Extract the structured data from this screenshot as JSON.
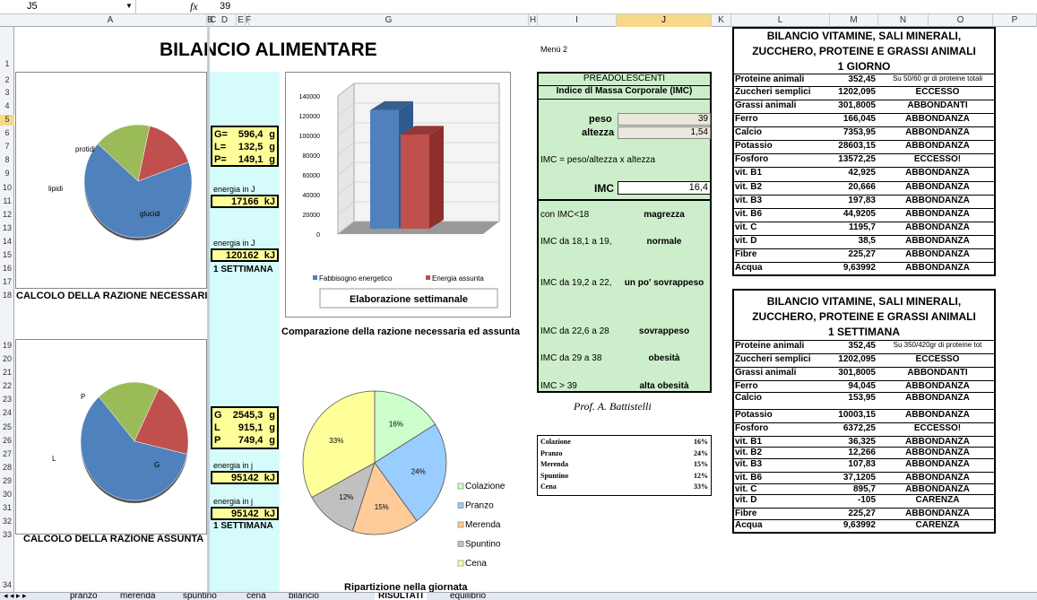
{
  "formula_bar": {
    "cell_ref": "J5",
    "fx": "fx",
    "value": "39"
  },
  "columns": [
    "A",
    "B",
    "C",
    "D",
    "E",
    "F",
    "G",
    "H",
    "I",
    "J",
    "K",
    "L",
    "M",
    "N",
    "O",
    "P"
  ],
  "rows": [
    "1",
    "2",
    "3",
    "4",
    "5",
    "6",
    "7",
    "8",
    "9",
    "10",
    "11",
    "12",
    "13",
    "14",
    "15",
    "16",
    "17",
    "18",
    "19",
    "20",
    "21",
    "22",
    "23",
    "24",
    "25",
    "26",
    "27",
    "28",
    "29",
    "30",
    "31",
    "32",
    "33",
    "34"
  ],
  "title": "BILANCIO ALIMENTARE",
  "menu_link": "Menù 2",
  "pie1": {
    "labels": [
      "protidi",
      "lipidi",
      "glucidi"
    ],
    "values": [
      17,
      16,
      67
    ],
    "colors": [
      "#9bbb59",
      "#c0504d",
      "#4f81bd"
    ]
  },
  "pie2": {
    "labels": [
      "P",
      "L",
      "G"
    ],
    "values": [
      19,
      21,
      60
    ],
    "colors": [
      "#9bbb59",
      "#c0504d",
      "#4f81bd"
    ]
  },
  "caption_necessaria": "CALCOLO DELLA RAZIONE NECESSARIA",
  "caption_assunta": "CALCOLO DELLA RAZIONE ASSUNTA",
  "box1": [
    {
      "k": "G=",
      "v": "596,4",
      "u": "g"
    },
    {
      "k": "L=",
      "v": "132,5",
      "u": "g"
    },
    {
      "k": "P=",
      "v": "149,1",
      "u": "g"
    }
  ],
  "energy1_label": "energia in J",
  "energy1": "17166",
  "energy_unit": "kJ",
  "energy2_label": "energia in J",
  "energy2": "120162",
  "settimana": "1 SETTIMANA",
  "box2": [
    {
      "k": "G",
      "v": "2545,3",
      "u": "g"
    },
    {
      "k": "L",
      "v": "915,1",
      "u": "g"
    },
    {
      "k": "P",
      "v": "749,4",
      "u": "g"
    }
  ],
  "energy3_label": "energia in j",
  "energy3": "95142",
  "energy4_label": "energia in j",
  "energy4": "95142",
  "bar_chart": {
    "yticks": [
      "140000",
      "120000",
      "100000",
      "80000",
      "60000",
      "40000",
      "20000",
      "0"
    ],
    "ylim": [
      0,
      140000
    ],
    "series": [
      {
        "name": "Fabbisogno energetico",
        "value": 120162,
        "color": "#4f81bd"
      },
      {
        "name": "Energia assunta",
        "value": 95142,
        "color": "#c0504d"
      }
    ],
    "title": "Elaborazione  settimanale"
  },
  "bar_caption": "Comparazione della razione necessaria ed assunta",
  "pie3": {
    "title": "Ripartizione nella giornata",
    "slices": [
      {
        "name": "Colazione",
        "value": 16,
        "label": "16%",
        "color": "#ccffcc"
      },
      {
        "name": "Pranzo",
        "value": 24,
        "label": "24%",
        "color": "#99ccff"
      },
      {
        "name": "Merenda",
        "value": 15,
        "label": "15%",
        "color": "#ffcc99"
      },
      {
        "name": "Spuntino",
        "value": 12,
        "label": "12%",
        "color": "#c0c0c0"
      },
      {
        "name": "Cena",
        "value": 33,
        "label": "33%",
        "color": "#ffff99"
      }
    ]
  },
  "imc": {
    "header": "PREADOLESCENTI",
    "title": "Indice dl Massa Corporale (IMC)",
    "peso_label": "peso",
    "peso": "39",
    "altezza_label": "altezza",
    "altezza": "1,54",
    "formula": "IMC = peso/altezza x altezza",
    "imc_label": "IMC",
    "imc_value": "16,4",
    "ranges": [
      {
        "r": "con IMC<18",
        "d": "magrezza"
      },
      {
        "r": "IMC da 18,1 a 19,",
        "d": "normale"
      },
      {
        "r": "IMC da 19,2 a 22,",
        "d": "un po' sovrappeso"
      },
      {
        "r": "IMC da 22,6 a 28",
        "d": "sovrappeso"
      },
      {
        "r": "IMC da 29 a 38",
        "d": "obesità"
      },
      {
        "r": "IMC > 39",
        "d": "alta obesità"
      }
    ]
  },
  "author": "Prof. A. Battistelli",
  "meals": [
    {
      "n": "Colazione",
      "p": "16%"
    },
    {
      "n": "Pranzo",
      "p": "24%"
    },
    {
      "n": "Merenda",
      "p": "15%"
    },
    {
      "n": "Spuntino",
      "p": "12%"
    },
    {
      "n": "Cena",
      "p": "33%"
    }
  ],
  "vit1": {
    "title": [
      "BILANCIO VITAMINE, SALI MINERALI,",
      "ZUCCHERO, PROTEINE E GRASSI ANIMALI",
      "1 GIORNO"
    ],
    "rows": [
      {
        "n": "Proteine animali",
        "v": "352,45",
        "s": "Su 50/60 gr di proteine totali"
      },
      {
        "n": "Zuccheri semplici",
        "v": "1202,095",
        "s": "ECCESSO"
      },
      {
        "n": "Grassi animali",
        "v": "301,8005",
        "s": "ABBONDANTI"
      },
      {
        "n": "Ferro",
        "v": "166,045",
        "s": "ABBONDANZA"
      },
      {
        "n": "Calcio",
        "v": "7353,95",
        "s": "ABBONDANZA"
      },
      {
        "n": "Potassio",
        "v": "28603,15",
        "s": "ABBONDANZA"
      },
      {
        "n": "Fosforo",
        "v": "13572,25",
        "s": "ECCESSO!"
      },
      {
        "n": "vit. B1",
        "v": "42,925",
        "s": "ABBONDANZA"
      },
      {
        "n": "vit. B2",
        "v": "20,666",
        "s": "ABBONDANZA"
      },
      {
        "n": "vit. B3",
        "v": "197,83",
        "s": "ABBONDANZA"
      },
      {
        "n": "vit. B6",
        "v": "44,9205",
        "s": "ABBONDANZA"
      },
      {
        "n": "vit. C",
        "v": "1195,7",
        "s": "ABBONDANZA"
      },
      {
        "n": "vit. D",
        "v": "38,5",
        "s": "ABBONDANZA"
      },
      {
        "n": "Fibre",
        "v": "225,27",
        "s": "ABBONDANZA"
      },
      {
        "n": "Acqua",
        "v": "9,63992",
        "s": "ABBONDANZA"
      }
    ]
  },
  "vit2": {
    "title": [
      "BILANCIO VITAMINE, SALI MINERALI,",
      "ZUCCHERO, PROTEINE E GRASSI ANIMALI",
      "1 SETTIMANA"
    ],
    "rows": [
      {
        "n": "Proteine animali",
        "v": "352,45",
        "s": "Su 350/420gr di proteine tot"
      },
      {
        "n": "Zuccheri semplici",
        "v": "1202,095",
        "s": "ECCESSO"
      },
      {
        "n": "Grassi animali",
        "v": "301,8005",
        "s": "ABBONDANTI"
      },
      {
        "n": "Ferro",
        "v": "94,045",
        "s": "ABBONDANZA"
      },
      {
        "n": "Calcio",
        "v": "153,95",
        "s": "ABBONDANZA"
      },
      {
        "n": "Potassio",
        "v": "10003,15",
        "s": "ABBONDANZA"
      },
      {
        "n": "Fosforo",
        "v": "6372,25",
        "s": "ECCESSO!"
      },
      {
        "n": "vit. B1",
        "v": "36,325",
        "s": "ABBONDANZA"
      },
      {
        "n": "vit. B2",
        "v": "12,266",
        "s": "ABBONDANZA"
      },
      {
        "n": "vit. B3",
        "v": "107,83",
        "s": "ABBONDANZA"
      },
      {
        "n": "vit. B6",
        "v": "37,1205",
        "s": "ABBONDANZA"
      },
      {
        "n": "vit. C",
        "v": "895,7",
        "s": "ABBONDANZA"
      },
      {
        "n": "vit. D",
        "v": "-105",
        "s": "CARENZA"
      },
      {
        "n": "Fibre",
        "v": "225,27",
        "s": "ABBONDANZA"
      },
      {
        "n": "Acqua",
        "v": "9,63992",
        "s": "CARENZA"
      }
    ]
  },
  "sheet_tabs": [
    "pranzo",
    "merenda",
    "spuntino",
    "cena",
    "bilancio",
    "RISULTATI",
    "equilibrio"
  ],
  "active_tab": "RISULTATI"
}
